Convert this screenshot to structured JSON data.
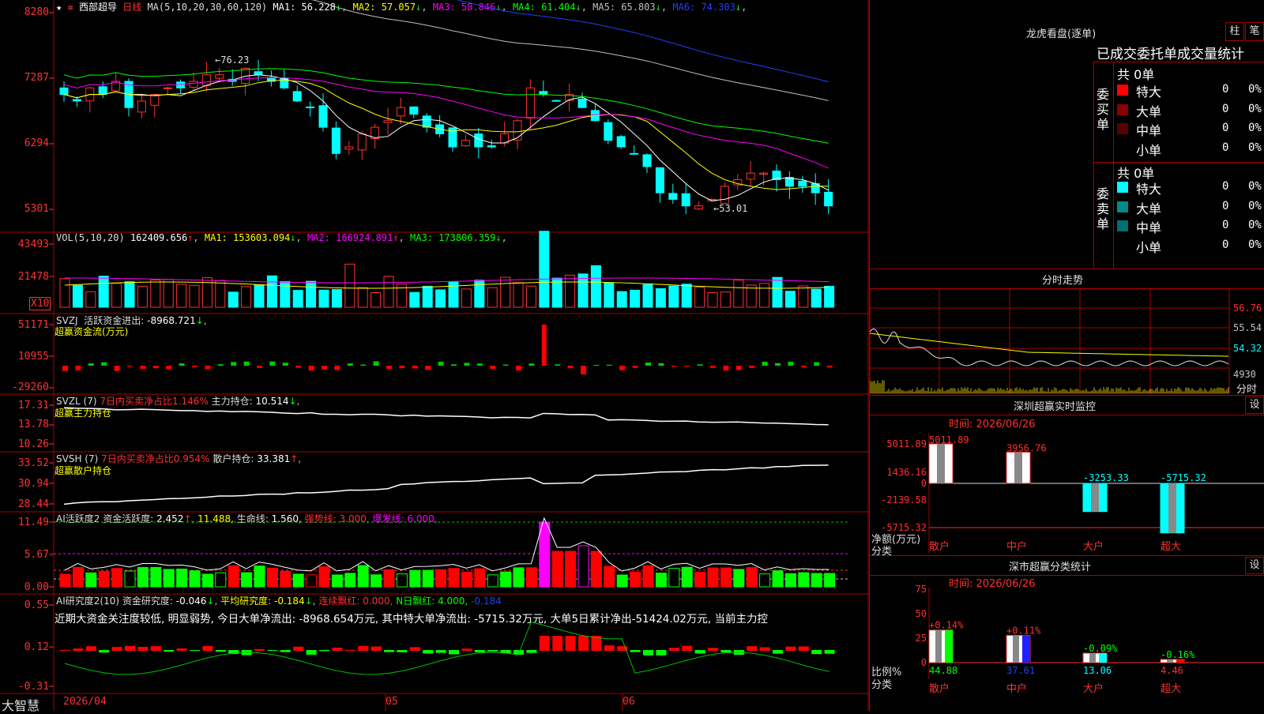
{
  "stock": {
    "star": "★",
    "name": "西部超导",
    "period": "日线"
  },
  "main_panel": {
    "ma_label": "MA(5,10,20,30,60,120)",
    "ma": [
      {
        "name": "MA1:",
        "value": "56.228",
        "arrow": "↓",
        "color": "#ffffff"
      },
      {
        "name": "MA2:",
        "value": "57.057",
        "arrow": "↓",
        "color": "#ffff00"
      },
      {
        "name": "MA3:",
        "value": "58.846",
        "arrow": "↓",
        "color": "#ff00ff"
      },
      {
        "name": "MA4:",
        "value": "61.404",
        "arrow": "↓",
        "color": "#00ff00"
      },
      {
        "name": "MA5:",
        "value": "65.803",
        "arrow": "↓",
        "color": "#c0c0c0"
      },
      {
        "name": "MA6:",
        "value": "74.303",
        "arrow": "↓",
        "color": "#2040ff"
      }
    ],
    "y_ticks": [
      "8280",
      "7287",
      "6294",
      "5301"
    ],
    "high_label": "←76.23",
    "low_label": "←53.01"
  },
  "vol_panel": {
    "label": "VOL(5,10,20)",
    "value": "162409.656",
    "ma": [
      {
        "name": "MA1:",
        "value": "153603.094",
        "arrow": "↓",
        "color": "#ffff00"
      },
      {
        "name": "MA2:",
        "value": "166924.891",
        "arrow": "↑",
        "color": "#ff00ff"
      },
      {
        "name": "MA3:",
        "value": "173806.359",
        "arrow": "↓",
        "color": "#00ff00"
      }
    ],
    "y_ticks": [
      "43493",
      "21478"
    ],
    "unit": "X10"
  },
  "svzj_panel": {
    "label": "SVZJ",
    "title": "活跃资金进出:",
    "value": "-8968.721",
    "sub": "超赢资金流(万元)",
    "y_ticks": [
      "51171",
      "10955",
      "-29260"
    ]
  },
  "svzl_panel": {
    "label": "SVZL (7)",
    "title": "7日内买卖净占比1.146%",
    "hold": "主力持仓:",
    "value": "10.514",
    "sub": "超赢主力持仓",
    "y_ticks": [
      "17.31",
      "13.78",
      "10.26"
    ]
  },
  "svsh_panel": {
    "label": "SVSH (7)",
    "title": "7日内买卖净占比0.954%",
    "hold": "散户持仓:",
    "value": "33.381",
    "sub": "超赢散户持仓",
    "y_ticks": [
      "33.52",
      "30.94",
      "28.44"
    ]
  },
  "ai_active": {
    "label": "AI活跃度2",
    "a_name": "资金活跃度:",
    "a_value": "2.452",
    "b_value": "11.488,",
    "c_name": "生命线:",
    "c_value": "1.560,",
    "d": "强势线: 3.000,",
    "e": "爆发线: 6.000,",
    "y_ticks": [
      "11.49",
      "5.67",
      "0.00"
    ]
  },
  "ai_research": {
    "label": "AI研究度2(10)",
    "a_name": "资金研究度:",
    "a_value": "-0.046",
    "b": "平均研究度: -0.184",
    "c": "连续飘红: 0.000,",
    "d": "N日飘红: 4.000,",
    "e": "-0.184",
    "comment": "近期大资金关注度较低, 明显弱势, 今日大单净流出: -8968.654万元, 其中特大单净流出: -5715.32万元, 大单5日累计净出-51424.02万元, 当前主力控",
    "y_ticks": [
      "0.55",
      "0.12",
      "-0.31"
    ]
  },
  "x_axis": {
    "brand": "大智慧",
    "date0": "2026/04",
    "m5": "05",
    "m6": "06"
  },
  "dragon_tiger": {
    "title": "龙虎看盘(逐单)",
    "btn_bar": "柱",
    "btn_tick": "笔",
    "tabs": "已成交委托单成交量统计",
    "buy_side": "委买单",
    "sell_side": "委卖单",
    "buy_total": "共 0单",
    "sell_total": "共 0单",
    "rows": [
      "特大",
      "大单",
      "中单",
      "小单"
    ],
    "buy_colors": [
      "#ff0000",
      "#8b0000",
      "#5a0000",
      ""
    ],
    "sell_colors": [
      "#00ffff",
      "#008b8b",
      "#007070",
      ""
    ],
    "qty": "0",
    "pct": "0%"
  },
  "intraday": {
    "title": "分时走势",
    "y_ticks": [
      "56.76",
      "55.54",
      "54.32"
    ],
    "vol_tick": "4930",
    "xlabel": "分时"
  },
  "sz_monitor": {
    "title": "深圳超赢实时监控",
    "btn": "设",
    "date": "时间: 2026/06/26",
    "y_ticks": [
      "5011.89",
      "1436.16",
      "0",
      "-2139.58",
      "-5715.32"
    ],
    "ylabel": "净额(万元)",
    "xlabel": "分类",
    "categories": [
      "散户",
      "中户",
      "大户",
      "超大"
    ],
    "values": [
      "5011.89",
      "3956.76",
      "-3253.33",
      "-5715.32"
    ]
  },
  "sz_class": {
    "title": "深市超赢分类统计",
    "btn": "设",
    "date": "时间: 2026/06/26",
    "y_ticks": [
      "75",
      "50",
      "25",
      "0"
    ],
    "ylabel": "比例%",
    "xlabel": "分类",
    "categories": [
      "散户",
      "中户",
      "大户",
      "超大"
    ],
    "changes": [
      "+0.14%",
      "+0.11%",
      "-0.09%",
      "-0.16%"
    ],
    "values": [
      "44.88",
      "37.61",
      "13.06",
      "4.46"
    ]
  }
}
